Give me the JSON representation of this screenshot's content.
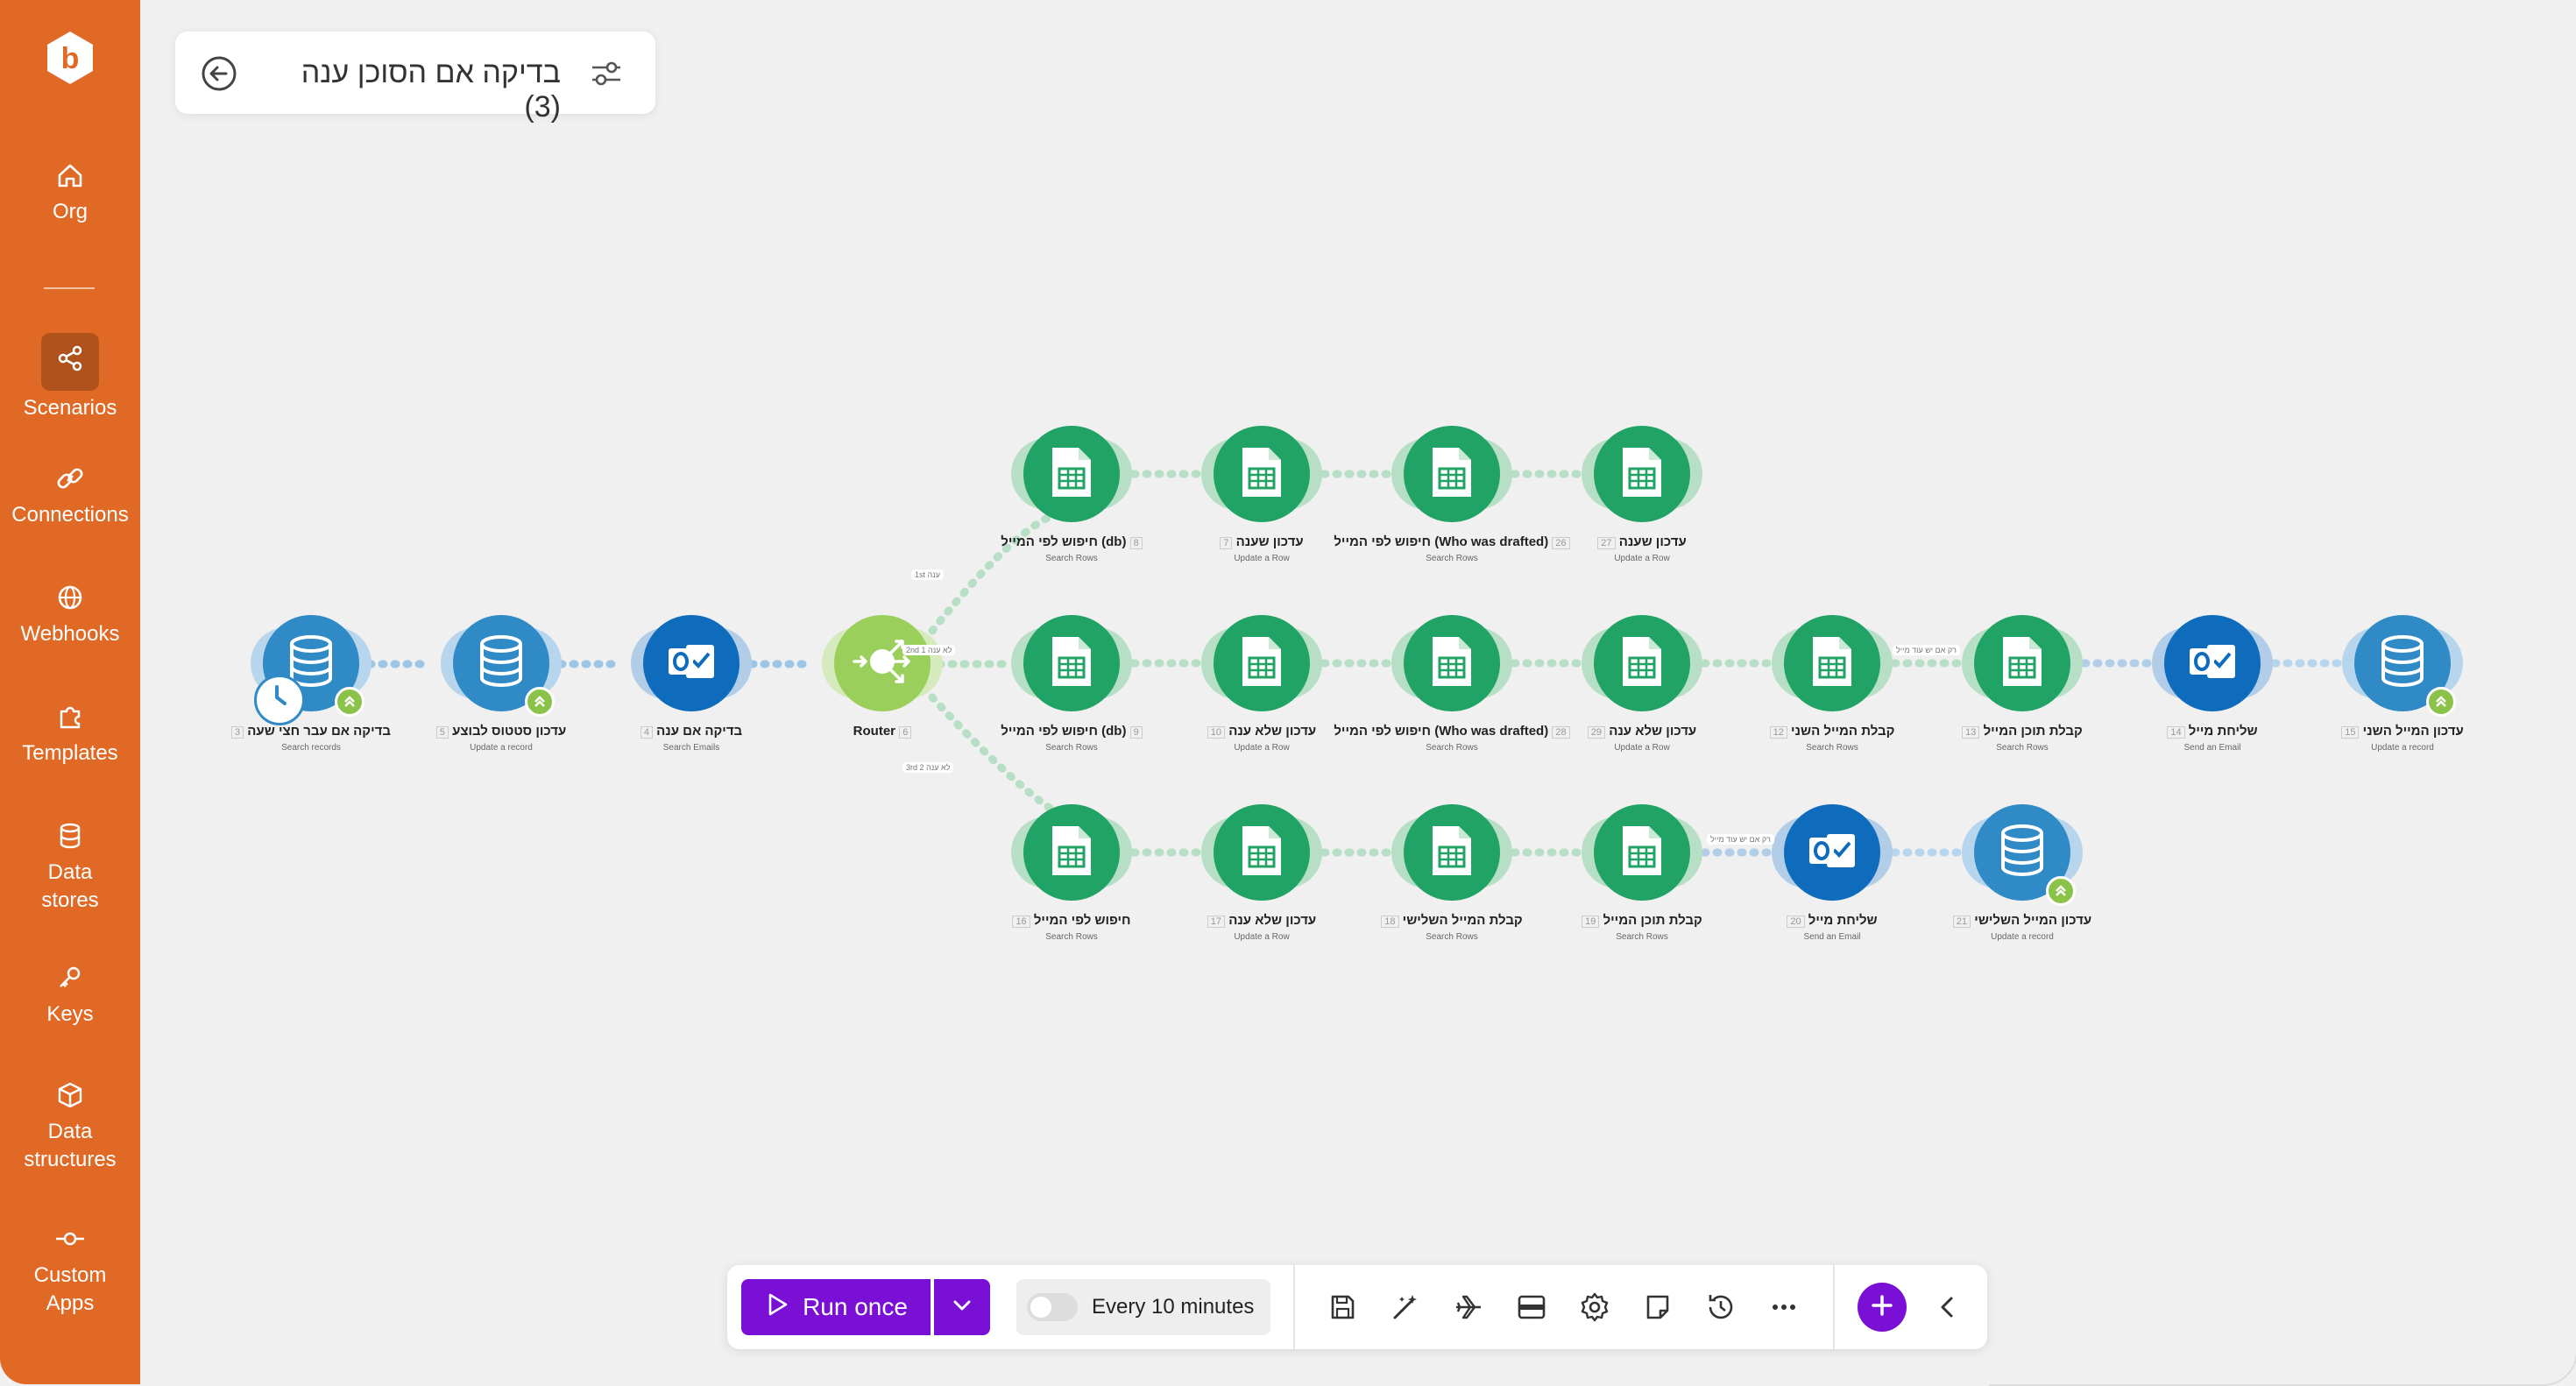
{
  "app": {
    "brand_color": "#e06a25",
    "accent_color": "#7a0fd6"
  },
  "sidebar": {
    "items": [
      {
        "label": "Org",
        "icon": "home-icon"
      },
      {
        "label": "Scenarios",
        "icon": "share-icon",
        "active": true
      },
      {
        "label": "Connections",
        "icon": "link-icon"
      },
      {
        "label": "Webhooks",
        "icon": "globe-icon"
      },
      {
        "label": "Templates",
        "icon": "puzzle-icon"
      },
      {
        "label": "Data stores",
        "icon": "database-icon"
      },
      {
        "label": "Keys",
        "icon": "key-icon"
      },
      {
        "label": "Data structures",
        "icon": "cube-icon"
      },
      {
        "label": "Custom Apps",
        "icon": "commit-icon"
      }
    ]
  },
  "scenario": {
    "title": "בדיקה אם הסוכן ענה (3)"
  },
  "nodes": {
    "n1": {
      "label": "בדיקה אם עבר חצי שעה",
      "sub": "Search records",
      "id": "3"
    },
    "n2": {
      "label": "עדכון סטטוס לבוצע",
      "sub": "Update a record",
      "id": "5"
    },
    "n3": {
      "label": "בדיקה אם ענה",
      "sub": "Search Emails",
      "id": "4"
    },
    "router": {
      "label": "Router",
      "id": "6"
    },
    "t1": {
      "label": "חיפוש לפי המייל (db)",
      "sub": "Search Rows",
      "id": "8"
    },
    "t2": {
      "label": "עדכון שענה",
      "sub": "Update a Row",
      "id": "7"
    },
    "t3": {
      "label": "חיפוש לפי המייל (Who was drafted)",
      "sub": "Search Rows",
      "id": "26"
    },
    "t4": {
      "label": "עדכון שענה",
      "sub": "Update a Row",
      "id": "27"
    },
    "m1": {
      "label": "חיפוש לפי המייל (db)",
      "sub": "Search Rows",
      "id": "9"
    },
    "m2": {
      "label": "עדכון שלא ענה",
      "sub": "Update a Row",
      "id": "10"
    },
    "m3": {
      "label": "חיפוש לפי המייל (Who was drafted)",
      "sub": "Search Rows",
      "id": "28"
    },
    "m4": {
      "label": "עדכון שלא ענה",
      "sub": "Update a Row",
      "id": "29"
    },
    "m5": {
      "label": "קבלת המייל השני",
      "sub": "Search Rows",
      "id": "12"
    },
    "m6": {
      "label": "קבלת תוכן המייל",
      "sub": "Search Rows",
      "id": "13"
    },
    "m7": {
      "label": "שליחת מייל",
      "sub": "Send an Email",
      "id": "14"
    },
    "m8": {
      "label": "עדכון המייל השני",
      "sub": "Update a record",
      "id": "15"
    },
    "b1": {
      "label": "חיפוש לפי המייל",
      "sub": "Search Rows",
      "id": "16"
    },
    "b2": {
      "label": "עדכון שלא ענה",
      "sub": "Update a Row",
      "id": "17"
    },
    "b3": {
      "label": "קבלת המייל השלישי",
      "sub": "Search Rows",
      "id": "18"
    },
    "b4": {
      "label": "קבלת תוכן המייל",
      "sub": "Search Rows",
      "id": "19"
    },
    "b5": {
      "label": "שליחת מייל",
      "sub": "Send an Email",
      "id": "20"
    },
    "b6": {
      "label": "עדכון המייל השלישי",
      "sub": "Update a record",
      "id": "21"
    }
  },
  "filters": {
    "route1": "1st ענה",
    "route2": "2nd לא ענה 1",
    "route3": "3rd לא ענה 2",
    "mid_filter": "רק אם יש עוד מייל",
    "bottom_filter": "רק אם יש עוד מייל"
  },
  "toolbar": {
    "run_label": "Run once",
    "schedule_label": "Every 10 minutes",
    "schedule_enabled": false
  }
}
